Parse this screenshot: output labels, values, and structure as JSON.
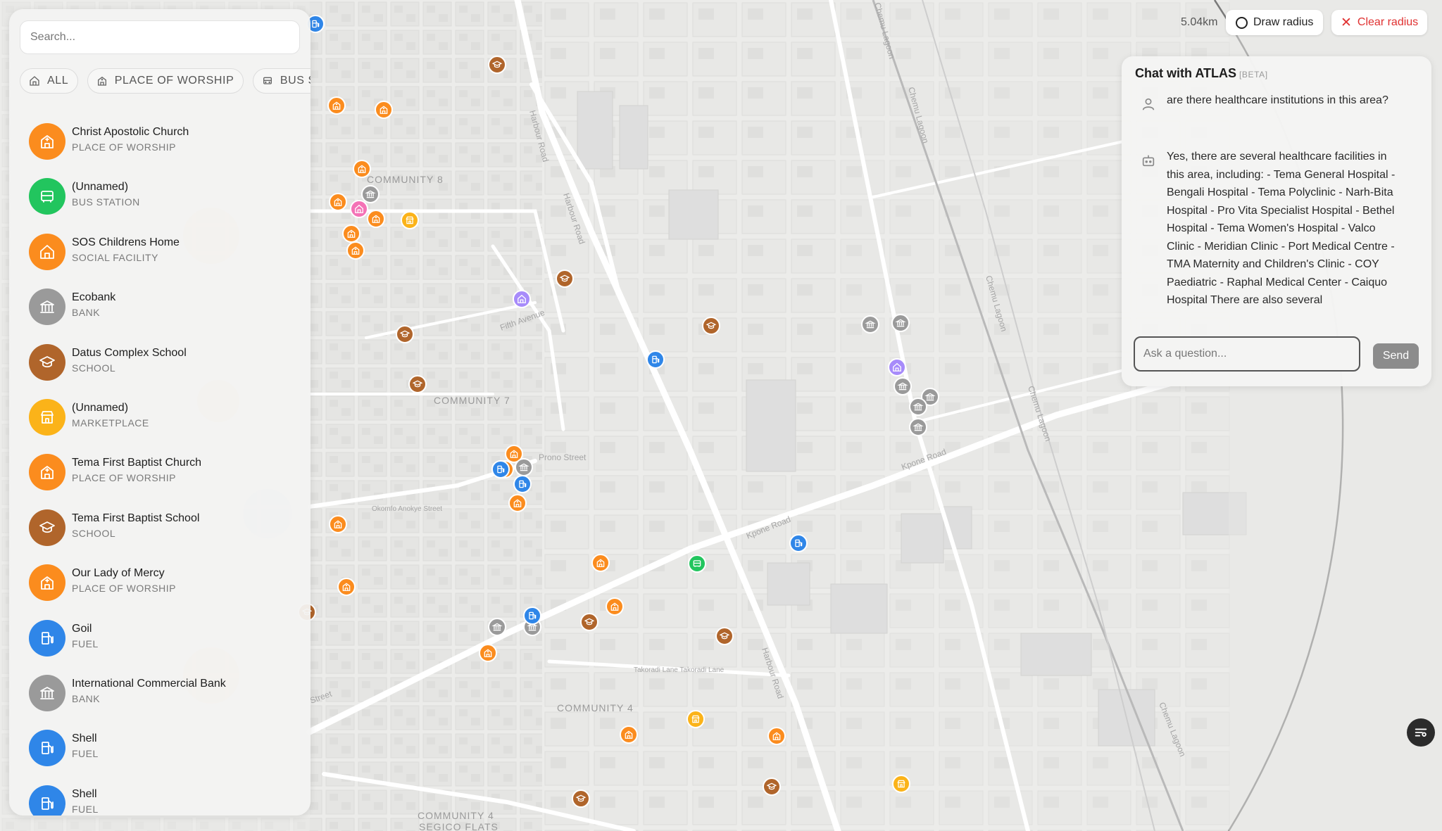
{
  "map": {
    "labels": {
      "community8": "COMMUNITY 8",
      "community7": "COMMUNITY 7",
      "community4": "COMMUNITY 4",
      "community4b": "COMMUNITY 4",
      "segico": "SEGICO FLATS",
      "harbour1": "Harbour Road",
      "harbour2": "Harbour Road",
      "harbour3": "Harbour Road",
      "fifth": "Fifth Avenue",
      "prono": "Prono Street",
      "okomfo": "Okomfo Anokye Street",
      "kpone1": "Kpone Road",
      "kpone2": "Kpone Road",
      "takoradi": "Takoradi Lane Takoradi Lane",
      "chemu1": "Chemu Lagoon",
      "chemu2": "Chemu Lagoon",
      "chemu3": "Chemu Lagoon",
      "chemu4": "Chemu Lagoon",
      "chemu5": "Chemu Lagoon",
      "street": "Street"
    }
  },
  "sidebar": {
    "search_placeholder": "Search...",
    "filters": [
      {
        "label": "ALL",
        "icon": "home-icon"
      },
      {
        "label": "PLACE OF WORSHIP",
        "icon": "worship-icon"
      },
      {
        "label": "BUS ST",
        "icon": "bus-icon"
      }
    ],
    "items": [
      {
        "name": "Christ Apostolic Church",
        "category": "PLACE OF WORSHIP",
        "icon": "worship-icon",
        "color": "#fb8c1e"
      },
      {
        "name": "(Unnamed)",
        "category": "BUS STATION",
        "icon": "bus-icon",
        "color": "#22c55e"
      },
      {
        "name": "SOS Childrens Home",
        "category": "SOCIAL FACILITY",
        "icon": "home-icon",
        "color": "#fb8c1e"
      },
      {
        "name": "Ecobank",
        "category": "BANK",
        "icon": "bank-icon",
        "color": "#9a9a9a"
      },
      {
        "name": "Datus Complex School",
        "category": "SCHOOL",
        "icon": "school-icon",
        "color": "#b0652b"
      },
      {
        "name": "(Unnamed)",
        "category": "MARKETPLACE",
        "icon": "market-icon",
        "color": "#fbb319"
      },
      {
        "name": "Tema First Baptist Church",
        "category": "PLACE OF WORSHIP",
        "icon": "worship-icon",
        "color": "#fb8c1e"
      },
      {
        "name": "Tema First Baptist School",
        "category": "SCHOOL",
        "icon": "school-icon",
        "color": "#b0652b"
      },
      {
        "name": "Our Lady of Mercy",
        "category": "PLACE OF WORSHIP",
        "icon": "worship-icon",
        "color": "#fb8c1e"
      },
      {
        "name": "Goil",
        "category": "FUEL",
        "icon": "fuel-icon",
        "color": "#2f86e8"
      },
      {
        "name": "International Commercial Bank",
        "category": "BANK",
        "icon": "bank-icon",
        "color": "#9a9a9a"
      },
      {
        "name": "Shell",
        "category": "FUEL",
        "icon": "fuel-icon",
        "color": "#2f86e8"
      },
      {
        "name": "Shell",
        "category": "FUEL",
        "icon": "fuel-icon",
        "color": "#2f86e8"
      }
    ]
  },
  "controls": {
    "radius": "5.04km",
    "draw_label": "Draw radius",
    "clear_label": "Clear radius",
    "clear_color": "#e03131"
  },
  "chat": {
    "title": "Chat with ATLAS",
    "beta": "[BETA]",
    "user_message": "are there healthcare institutions in this area?",
    "bot_message": "Yes, there are several healthcare facilities in this area, including: - Tema General Hospital - Bengali Hospital - Tema Polyclinic - Narh-Bita Hospital - Pro Vita Specialist Hospital - Bethel Hospital - Tema Women's Hospital - Valco Clinic - Meridian Clinic - Port Medical Centre - TMA Maternity and Children's Clinic - COY Paediatric - Raphal Medical Center - Caiquo Hospital There are also several",
    "input_placeholder": "Ask a question...",
    "send_label": "Send"
  },
  "colors": {
    "worship": "#fb8c1e",
    "school": "#b0652b",
    "bank": "#9a9a9a",
    "fuel": "#2f86e8",
    "market": "#fbb319",
    "bus": "#22c55e",
    "social": "#a78bfa",
    "health": "#f472b6"
  }
}
